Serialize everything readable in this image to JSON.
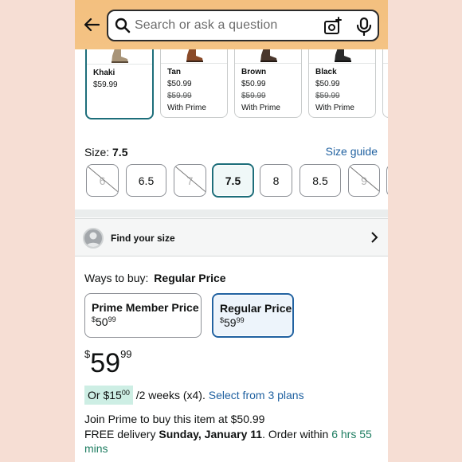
{
  "search": {
    "placeholder": "Search or ask a question"
  },
  "icons": {
    "back": "back-arrow-icon",
    "search": "search-icon",
    "camera": "camera-icon",
    "mic": "microphone-icon",
    "chevron": "chevron-right-icon",
    "avatar": "person-icon"
  },
  "swatches": [
    {
      "name": "Khaki",
      "price": "$59.99",
      "strike": "",
      "prime": "",
      "color": "#a89478"
    },
    {
      "name": "Tan",
      "price": "$50.99",
      "strike": "$59.99",
      "prime": "With Prime",
      "color": "#8a4a28"
    },
    {
      "name": "Brown",
      "price": "$50.99",
      "strike": "$59.99",
      "prime": "With Prime",
      "color": "#4a372d"
    },
    {
      "name": "Black",
      "price": "$50.99",
      "strike": "$59.99",
      "prime": "With Prime",
      "color": "#2a2a2a"
    }
  ],
  "size": {
    "label": "Size:",
    "selected": "7.5",
    "guide": "Size guide",
    "options": [
      {
        "value": "6",
        "available": false
      },
      {
        "value": "6.5",
        "available": true
      },
      {
        "value": "7",
        "available": false
      },
      {
        "value": "7.5",
        "available": true,
        "selected": true
      },
      {
        "value": "8",
        "available": true
      },
      {
        "value": "8.5",
        "available": true
      },
      {
        "value": "9",
        "available": false
      }
    ]
  },
  "find_size": {
    "label": "Find your size"
  },
  "ways": {
    "label": "Ways to buy:",
    "selected": "Regular Price",
    "options": [
      {
        "title": "Prime Member Price",
        "currency": "$",
        "whole": "50",
        "fraction": "99"
      },
      {
        "title": "Regular Price",
        "currency": "$",
        "whole": "59",
        "fraction": "99"
      }
    ]
  },
  "price": {
    "currency": "$",
    "whole": "59",
    "fraction": "99"
  },
  "installment": {
    "prefix": "Or $",
    "whole": "15",
    "fraction": "00",
    "suffix": "/2 weeks (x4).",
    "link": "Select from 3 plans"
  },
  "join": "Join Prime to buy this item at $50.99",
  "delivery": {
    "prefix": "FREE delivery",
    "date": "Sunday, January 11",
    "middle": ". Order within",
    "countdown": "6 hrs 55 mins"
  },
  "colors": {
    "accent_teal": "#1d6e7a",
    "link_blue": "#2162a1",
    "header": "#f3c07f",
    "green": "#1e7d61"
  }
}
